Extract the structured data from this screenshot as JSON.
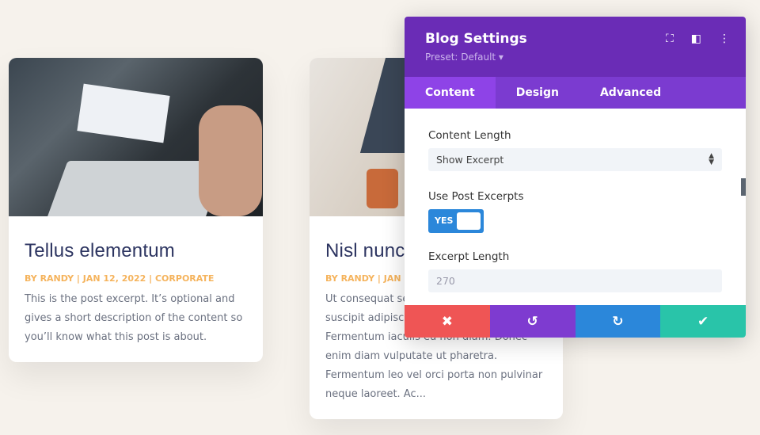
{
  "posts": [
    {
      "title": "Tellus elementum",
      "meta": "BY RANDY | JAN 12, 2022 | CORPORATE",
      "excerpt": "This is the post excerpt. It’s optional and gives a short description of the content so you’ll know what this post is about."
    },
    {
      "title": "Nisl nunc",
      "meta": "BY RANDY | JAN 12,",
      "excerpt": "Ut consequat sem laoreet sit amet. suscipit adipiscing bibendum est ultricies. Fermentum iaculis eu non diam. Donec enim diam vulputate ut pharetra. Fermentum leo vel orci porta non pulvinar neque laoreet. Ac..."
    }
  ],
  "panel": {
    "title": "Blog Settings",
    "preset": "Preset: Default ▾",
    "icons": [
      "fullscreen-icon",
      "sidebar-layout-icon",
      "more-vertical-icon"
    ],
    "tabs": [
      "Content",
      "Design",
      "Advanced"
    ],
    "content_length_label": "Content Length",
    "content_length_value": "Show Excerpt",
    "use_excerpts_label": "Use Post Excerpts",
    "use_excerpts_value": "YES",
    "excerpt_length_label": "Excerpt Length",
    "excerpt_length_placeholder": "270",
    "footer": {
      "cancel": "✖",
      "undo": "↺",
      "redo": "↻",
      "save": "✔"
    },
    "colors": {
      "header": "#6a2cb6",
      "tabs": "#7b3bd0",
      "cancel": "#ef5555",
      "undo": "#7e3bd0",
      "redo": "#2b87da",
      "save": "#29c4a9"
    }
  }
}
